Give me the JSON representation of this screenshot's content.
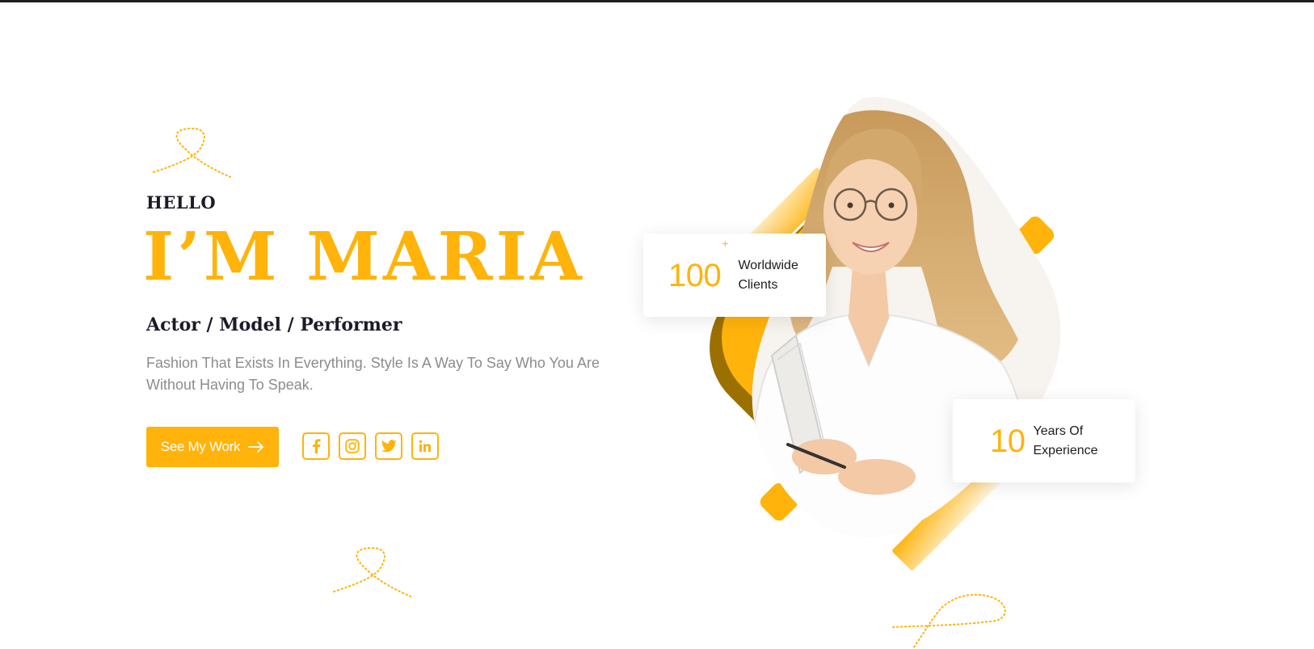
{
  "hero": {
    "greeting": "HELLO",
    "headline": "I’M MARIA",
    "roles": "Actor / Model / Performer",
    "tagline": "Fashion That Exists In Everything. Style Is A Way To Say Who You Are Without Having To Speak.",
    "cta_label": "See My Work"
  },
  "socials": [
    {
      "name": "facebook",
      "icon": "facebook-icon"
    },
    {
      "name": "instagram",
      "icon": "instagram-icon"
    },
    {
      "name": "twitter",
      "icon": "twitter-icon"
    },
    {
      "name": "linkedin",
      "icon": "linkedin-icon"
    }
  ],
  "stats": {
    "clients": {
      "value": "100",
      "suffix": "+",
      "label": "Worldwide\nClients"
    },
    "experience": {
      "value": "10",
      "suffix": "",
      "label": "Years Of\nExperience"
    }
  },
  "colors": {
    "accent": "#ffb30b",
    "accent_dark": "#9b6f00",
    "heading": "#1b1b2a",
    "body_text": "#8c8c8c",
    "top_bar": "#1d1d1d"
  }
}
